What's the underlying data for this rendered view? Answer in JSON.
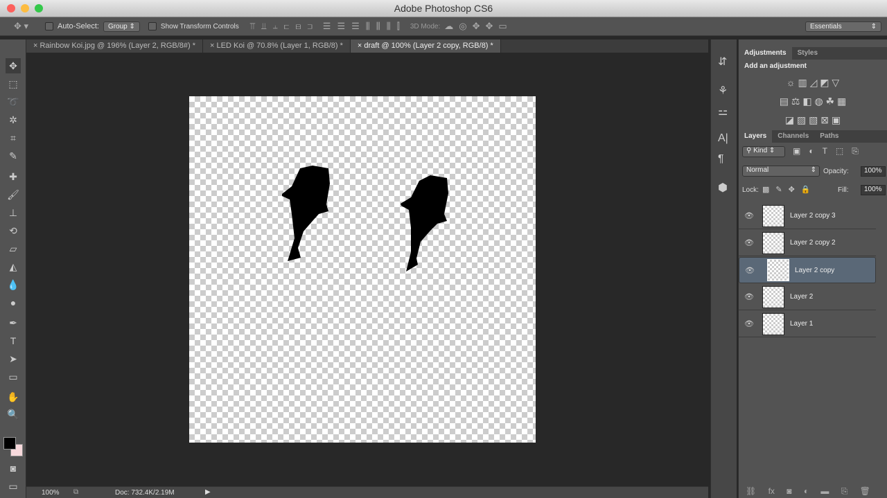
{
  "app": {
    "title": "Adobe Photoshop CS6"
  },
  "options": {
    "auto_select": "Auto-Select:",
    "group": "Group",
    "show_transform": "Show Transform Controls",
    "mode_3d": "3D Mode:",
    "workspace": "Essentials"
  },
  "tabs": [
    {
      "label": "Rainbow Koi.jpg @ 196% (Layer 2, RGB/8#) *"
    },
    {
      "label": "LED Koi @ 70.8% (Layer 1, RGB/8) *"
    },
    {
      "label": "draft @ 100% (Layer 2 copy, RGB/8) *"
    }
  ],
  "status": {
    "zoom": "100%",
    "doc": "Doc: 732.4K/2.19M"
  },
  "adjustments": {
    "tab": "Adjustments",
    "styles_tab": "Styles",
    "heading": "Add an adjustment"
  },
  "layers_panel": {
    "tabs": [
      "Layers",
      "Channels",
      "Paths"
    ],
    "kind": "Kind",
    "blend": "Normal",
    "opacity_label": "Opacity:",
    "opacity": "100%",
    "lock_label": "Lock:",
    "fill_label": "Fill:",
    "fill": "100%"
  },
  "layers": [
    {
      "name": "Layer 2 copy 3",
      "selected": false
    },
    {
      "name": "Layer 2 copy 2",
      "selected": false
    },
    {
      "name": "Layer 2 copy",
      "selected": true
    },
    {
      "name": "Layer 2",
      "selected": false
    },
    {
      "name": "Layer 1",
      "selected": false
    }
  ],
  "colors": {
    "foreground": "#000000",
    "background": "#f7d9dc",
    "selection": "#5a6877"
  }
}
